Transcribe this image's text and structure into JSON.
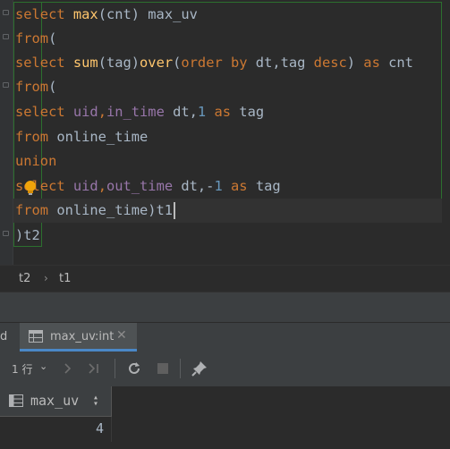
{
  "editor": {
    "lines": [
      [
        {
          "t": "select ",
          "c": "kw"
        },
        {
          "t": "max",
          "c": "fn"
        },
        {
          "t": "(cnt) max_uv",
          "c": "id"
        }
      ],
      [
        {
          "t": "from",
          "c": "kw"
        },
        {
          "t": "(",
          "c": "id"
        }
      ],
      [
        {
          "t": "select ",
          "c": "kw"
        },
        {
          "t": "sum",
          "c": "fn"
        },
        {
          "t": "(tag)",
          "c": "id"
        },
        {
          "t": "over",
          "c": "fn"
        },
        {
          "t": "(",
          "c": "id"
        },
        {
          "t": "order by",
          "c": "kw"
        },
        {
          "t": " dt,tag ",
          "c": "id"
        },
        {
          "t": "desc",
          "c": "kw"
        },
        {
          "t": ") ",
          "c": "id"
        },
        {
          "t": "as",
          "c": "kw"
        },
        {
          "t": " cnt",
          "c": "id"
        }
      ],
      [
        {
          "t": "from",
          "c": "kw"
        },
        {
          "t": "(",
          "c": "id"
        }
      ],
      [
        {
          "t": "select ",
          "c": "kw"
        },
        {
          "t": "uid",
          "c": "col"
        },
        {
          "t": ",",
          "c": "kw"
        },
        {
          "t": "in_time",
          "c": "col"
        },
        {
          "t": " dt,",
          "c": "id"
        },
        {
          "t": "1",
          "c": "num"
        },
        {
          "t": " ",
          "c": "id"
        },
        {
          "t": "as",
          "c": "kw"
        },
        {
          "t": " tag",
          "c": "id"
        }
      ],
      [
        {
          "t": "from",
          "c": "kw"
        },
        {
          "t": " online_time",
          "c": "id"
        }
      ],
      [
        {
          "t": "union",
          "c": "kw"
        }
      ],
      [
        {
          "t": "select ",
          "c": "kw"
        },
        {
          "t": "uid",
          "c": "col"
        },
        {
          "t": ",",
          "c": "kw"
        },
        {
          "t": "out_time",
          "c": "col"
        },
        {
          "t": " dt,-",
          "c": "id"
        },
        {
          "t": "1",
          "c": "num"
        },
        {
          "t": " ",
          "c": "id"
        },
        {
          "t": "as",
          "c": "kw"
        },
        {
          "t": " tag",
          "c": "id"
        }
      ],
      [
        {
          "t": "from",
          "c": "kw"
        },
        {
          "t": " online_time)t1",
          "c": "id"
        }
      ],
      [
        {
          "t": ")t2",
          "c": "id"
        }
      ]
    ]
  },
  "breadcrumb": {
    "items": [
      "t2",
      "t1"
    ]
  },
  "tabs": {
    "prev_partial": "d",
    "active_label": "max_uv:int"
  },
  "toolbar": {
    "rows_label": "1 行"
  },
  "result": {
    "columns": [
      "max_uv"
    ],
    "rows": [
      [
        "4"
      ]
    ]
  },
  "colors": {
    "keyword": "#cc7832",
    "function": "#ffc66d",
    "column": "#9876aa",
    "number": "#6897bb",
    "text": "#a9b7c6",
    "accent": "#4a88c7"
  }
}
